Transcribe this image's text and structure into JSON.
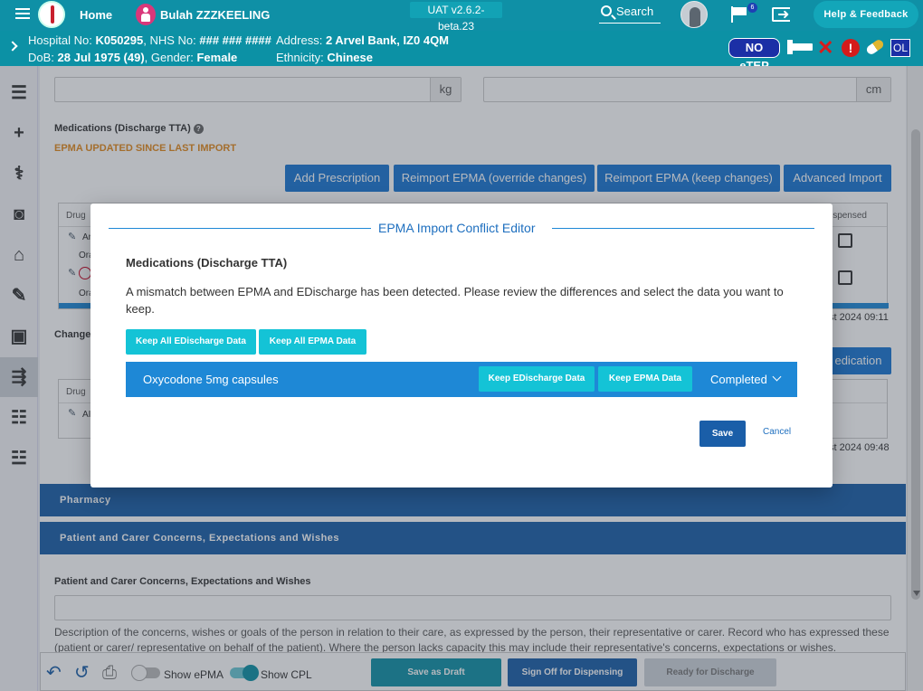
{
  "header": {
    "home_label": "Home",
    "patient_name": "Bulah ZZZKEELING",
    "version": "UAT v2.6.2-beta.23",
    "search_label": "Search",
    "notification_count": "6",
    "help_label": "Help & Feedback"
  },
  "banner": {
    "hospital_no_label": "Hospital No:",
    "hospital_no": "K050295",
    "nhs_label": ", NHS No:",
    "nhs_no": "### ### ####",
    "dob_label": "DoB:",
    "dob": "28 Jul 1975 (49)",
    "gender_label": ", Gender:",
    "gender": "Female",
    "address_label": "Address:",
    "address": "2 Arvel Bank, IZ0 4QM",
    "ethnicity_label": "Ethnicity:",
    "ethnicity": "Chinese",
    "netep_label": "NO eTEP",
    "ol_label": "OL"
  },
  "main": {
    "weight_unit": "kg",
    "height_unit": "cm",
    "meds_section_label": "Medications (Discharge TTA)",
    "epma_warning": "EPMA UPDATED SINCE LAST IMPORT",
    "buttons": {
      "add_prescription": "Add Prescription",
      "reimport_override": "Reimport EPMA (override changes)",
      "reimport_keep": "Reimport EPMA (keep changes)",
      "advanced_import": "Advanced Import",
      "medication": "edication"
    },
    "table1": {
      "col_drug": "Drug",
      "col_dispensed": "spensed",
      "row1_drug": "An",
      "row1_sub": "Ora",
      "row2_sub": "Ora"
    },
    "timestamp1": "st 2024 09:11",
    "changes_label": "Changes",
    "table2": {
      "col_drug": "Drug",
      "row1_drug": "AI"
    },
    "timestamp2": "st 2024 09:48",
    "pharmacy_title": "Pharmacy",
    "concerns_title": "Patient and Carer Concerns, Expectations and Wishes",
    "concerns_label": "Patient and Carer Concerns, Expectations and Wishes",
    "concerns_desc": "Description of the concerns, wishes or goals of the person in relation to their care, as expressed by the person, their representative or carer. Record who has expressed these (patient or carer/ representative on behalf of the patient). Where the person lacks capacity this may include their representative's concerns, expectations or wishes."
  },
  "footer": {
    "show_epma": "Show ePMA",
    "show_cpl": "Show CPL",
    "save_draft": "Save as Draft",
    "sign_off": "Sign Off for Dispensing",
    "ready": "Ready for Discharge"
  },
  "modal": {
    "title": "EPMA Import Conflict Editor",
    "subtitle": "Medications (Discharge TTA)",
    "message": "A mismatch between EPMA and EDischarge has been detected. Please review the differences and select the data you want to keep.",
    "keep_all_edischarge": "Keep All EDischarge Data",
    "keep_all_epma": "Keep All EPMA Data",
    "medication_name": "Oxycodone 5mg capsules",
    "keep_edischarge": "Keep EDischarge Data",
    "keep_epma": "Keep EPMA Data",
    "status": "Completed",
    "save": "Save",
    "cancel": "Cancel"
  },
  "colors": {
    "header_teal": "#0f90a6",
    "primary_blue": "#1976d2",
    "cyan_button": "#14c3d6",
    "warning_orange": "#e38a1d",
    "alert_red": "#d51b1b"
  }
}
